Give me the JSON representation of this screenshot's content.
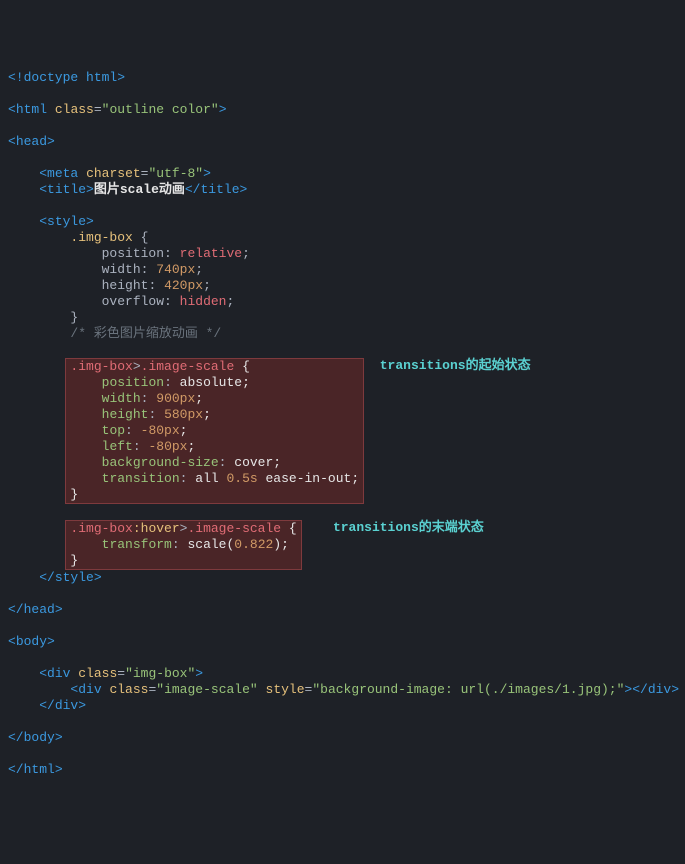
{
  "doctype": "<!doctype html>",
  "html_open": {
    "tag": "html",
    "attr": "class",
    "val": "\"outline color\""
  },
  "head_open": {
    "tag": "head"
  },
  "meta": {
    "tag": "meta",
    "attr": "charset",
    "val": "\"utf-8\""
  },
  "title": {
    "tag": "title",
    "text": "图片scale动画"
  },
  "style_open": "style",
  "rule1": {
    "selector": ".img-box",
    "props": [
      {
        "name": "position",
        "val": "relative"
      },
      {
        "name": "width",
        "val": "740px"
      },
      {
        "name": "height",
        "val": "420px"
      },
      {
        "name": "overflow",
        "val": "hidden"
      }
    ]
  },
  "comment1": "/* 彩色图片缩放动画 */",
  "rule2": {
    "selector_parts": [
      ".img-box",
      ">",
      ".image-scale"
    ],
    "props": [
      {
        "name": "position",
        "sep": ": ",
        "val": "absolute",
        "end": ";"
      },
      {
        "name": "width",
        "sep": ": ",
        "val_num": "900px",
        "end": ";"
      },
      {
        "name": "height",
        "sep": ": ",
        "val_num": "580px",
        "end": ";"
      },
      {
        "name": "top",
        "sep": ": ",
        "val_num": "-80px",
        "end": ";"
      },
      {
        "name": "left",
        "sep": ": ",
        "val_num": "-80px",
        "end": ";"
      },
      {
        "name": "background-size",
        "sep": ": ",
        "val": "cover",
        "end": ";"
      },
      {
        "name": "transition",
        "sep": ": ",
        "val_multi": "all 0.5s ease-in-out",
        "end": ";"
      }
    ]
  },
  "annot1": "transitions的起始状态",
  "rule3": {
    "selector_parts": [
      ".img-box",
      ":hover",
      ">",
      ".image-scale"
    ],
    "prop": {
      "name": "transform",
      "sep": ": ",
      "fn": "scale",
      "arg": "0.822",
      "end": ";"
    }
  },
  "annot2": "transitions的末端状态",
  "style_close": "style",
  "head_close": "head",
  "body_open": "body",
  "div1": {
    "tag": "div",
    "attr": "class",
    "val": "\"img-box\""
  },
  "div2": {
    "tag": "div",
    "attr1": "class",
    "val1": "\"image-scale\"",
    "attr2": "style",
    "val2": "\"background-image: url(./images/1.jpg);\""
  },
  "div_close": "div",
  "body_close": "body",
  "html_close": "html"
}
